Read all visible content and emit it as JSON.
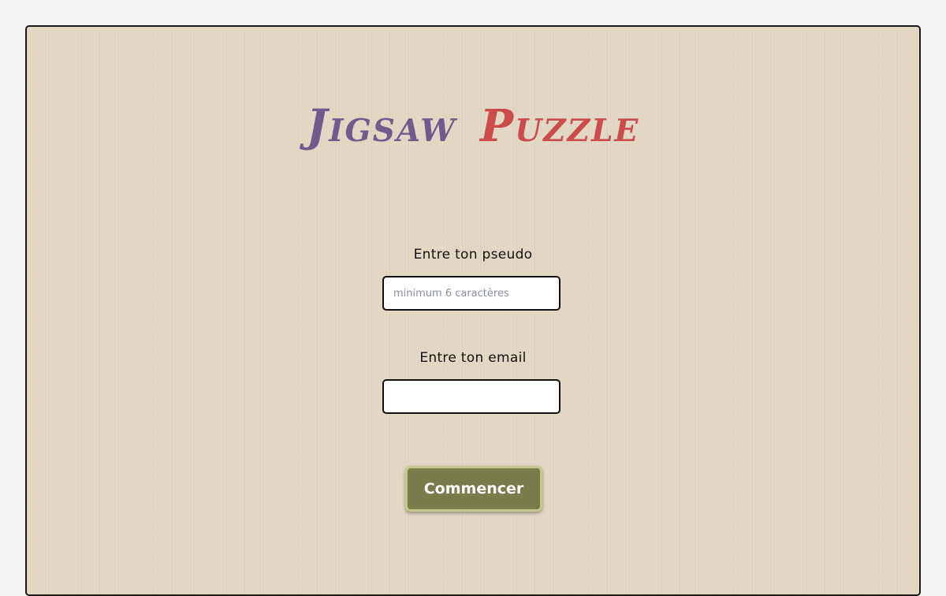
{
  "header": {
    "title_word_1": "Jigsaw",
    "title_word_2": "Puzzle"
  },
  "form": {
    "pseudo_label": "Entre ton pseudo",
    "pseudo_placeholder": "minimum 6 caractères",
    "pseudo_value": "",
    "email_label": "Entre ton email",
    "email_placeholder": "",
    "email_value": "",
    "submit_label": "Commencer"
  },
  "colors": {
    "page_background": "#f3f3f3",
    "panel_background": "#e2d8c3",
    "title_word_1": "#715a8e",
    "title_word_2": "#cc4b4b",
    "button_fill": "#7a7b4a",
    "button_border": "#c2c889"
  }
}
